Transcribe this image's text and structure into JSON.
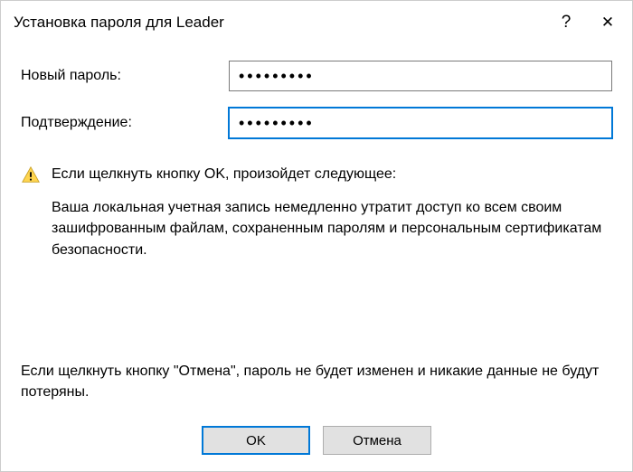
{
  "titlebar": {
    "title": "Установка пароля для Leader",
    "help": "?",
    "close": "✕"
  },
  "form": {
    "new_password_label": "Новый пароль:",
    "new_password_value": "•••••••••",
    "confirm_label": "Подтверждение:",
    "confirm_value": "•••••••••"
  },
  "warning": {
    "heading": "Если щелкнуть кнопку OK, произойдет следующее:",
    "body": "Ваша локальная учетная запись немедленно утратит доступ ко всем своим зашифрованным файлам, сохраненным паролям и персональным сертификатам безопасности."
  },
  "cancel_note": "Если щелкнуть кнопку \"Отмена\", пароль не будет изменен и никакие данные не будут потеряны.",
  "buttons": {
    "ok": "OK",
    "cancel": "Отмена"
  }
}
